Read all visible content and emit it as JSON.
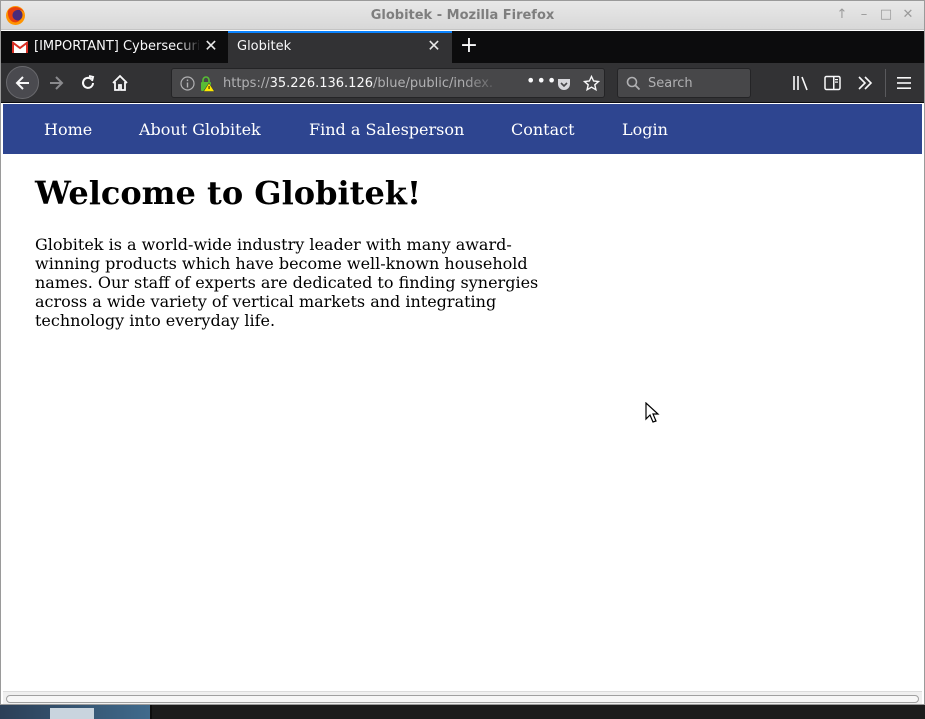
{
  "window": {
    "title": "Globitek - Mozilla Firefox"
  },
  "tabs": [
    {
      "label": "[IMPORTANT] Cybersecurity",
      "icon": "gmail-icon",
      "active": false
    },
    {
      "label": "Globitek",
      "icon": null,
      "active": true
    }
  ],
  "toolbar": {
    "url_scheme": "https://",
    "url_host": "35.226.136.126",
    "url_path": "/blue/public/index.php",
    "search_placeholder": "Search"
  },
  "site": {
    "nav": [
      "Home",
      "About Globitek",
      "Find a Salesperson",
      "Contact",
      "Login"
    ],
    "nav_color": "#2e4590",
    "heading": "Welcome to Globitek!",
    "body": "Globitek is a world-wide industry leader with many award-winning products which have become well-known household names. Our staff of experts are dedicated to finding synergies across a wide variety of vertical markets and integrating technology into everyday life."
  },
  "colors": {
    "tab_active_accent": "#0a84ff",
    "toolbar_bg": "#323234",
    "tabstrip_bg": "#0c0c0d"
  }
}
